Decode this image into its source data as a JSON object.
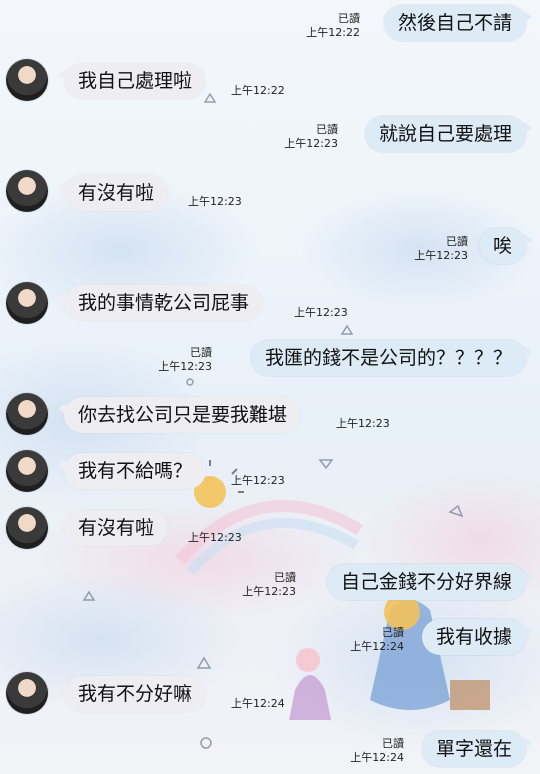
{
  "messages": [
    {
      "side": "right",
      "text": "然後自己不請",
      "read": "已讀",
      "time": "上午12:22"
    },
    {
      "side": "left",
      "text": "我自己處理啦",
      "time": "上午12:22"
    },
    {
      "side": "right",
      "text": "就說自己要處理",
      "read": "已讀",
      "time": "上午12:23"
    },
    {
      "side": "left",
      "text": "有沒有啦",
      "time": "上午12:23"
    },
    {
      "side": "right",
      "text": "唉",
      "read": "已讀",
      "time": "上午12:23"
    },
    {
      "side": "left",
      "text": "我的事情乾公司屁事",
      "time": "上午12:23"
    },
    {
      "side": "right",
      "text": "我匯的錢不是公司的？？？？",
      "read": "已讀",
      "time": "上午12:23"
    },
    {
      "side": "left",
      "text": "你去找公司只是要我難堪",
      "time": "上午12:23"
    },
    {
      "side": "left",
      "text": "我有不給嗎？",
      "time": "上午12:23"
    },
    {
      "side": "left",
      "text": "有沒有啦",
      "time": "上午12:23"
    },
    {
      "side": "right",
      "text": "自己金錢不分好界線",
      "read": "已讀",
      "time": "上午12:23"
    },
    {
      "side": "right",
      "text": "我有收據",
      "read": "已讀",
      "time": "上午12:24"
    },
    {
      "side": "left",
      "text": "我有不分好嘛",
      "time": "上午12:24"
    },
    {
      "side": "right",
      "text": "單字還在",
      "read": "已讀",
      "time": "上午12:24"
    }
  ]
}
